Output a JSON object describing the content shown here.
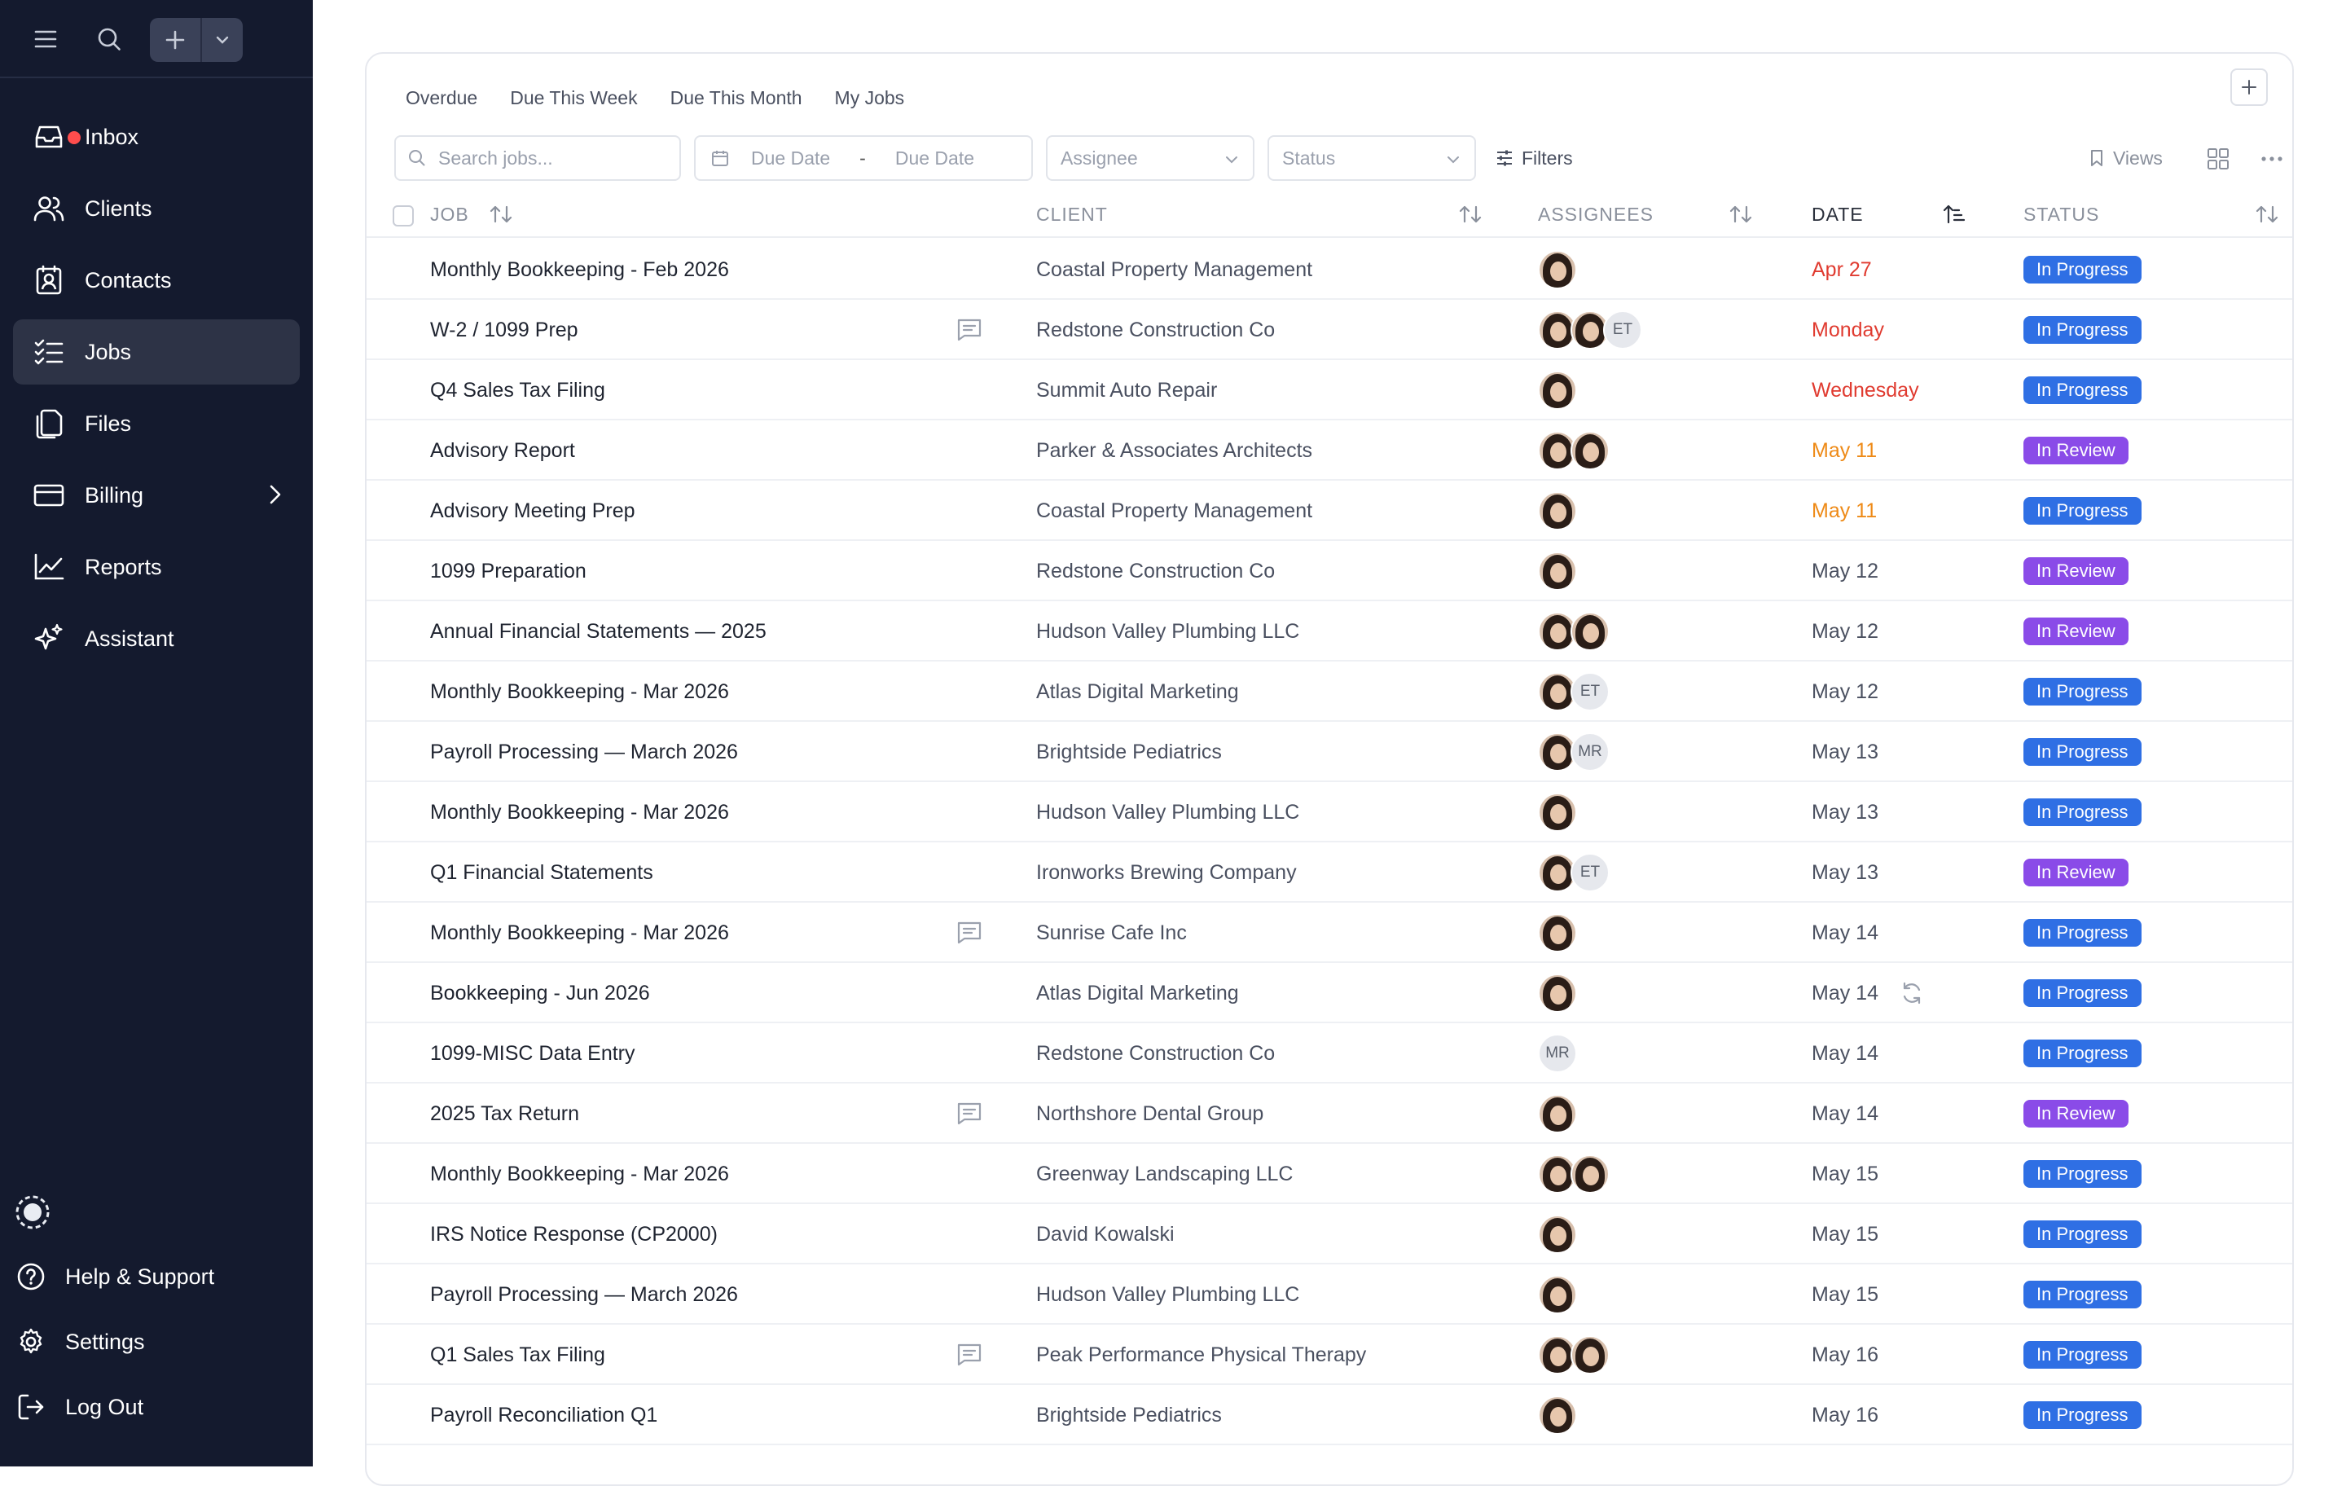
{
  "sidebar": {
    "nav": [
      {
        "label": "Inbox",
        "icon": "inbox-icon",
        "active": false,
        "badge": true
      },
      {
        "label": "Clients",
        "icon": "users-icon",
        "active": false
      },
      {
        "label": "Contacts",
        "icon": "contact-book-icon",
        "active": false
      },
      {
        "label": "Jobs",
        "icon": "checklist-icon",
        "active": true
      },
      {
        "label": "Files",
        "icon": "files-icon",
        "active": false
      },
      {
        "label": "Billing",
        "icon": "credit-card-icon",
        "active": false,
        "expandable": true
      },
      {
        "label": "Reports",
        "icon": "line-chart-icon",
        "active": false
      },
      {
        "label": "Assistant",
        "icon": "sparkles-icon",
        "active": false
      }
    ],
    "bottom": [
      {
        "label": "Help & Support",
        "icon": "help-circle-icon"
      },
      {
        "label": "Settings",
        "icon": "gear-icon"
      },
      {
        "label": "Log Out",
        "icon": "logout-icon"
      }
    ]
  },
  "tabs": [
    "Overdue",
    "Due This Week",
    "Due This Month",
    "My Jobs"
  ],
  "toolbar": {
    "search_placeholder": "Search jobs...",
    "due_date_start": "Due Date",
    "due_date_separator": "-",
    "due_date_end": "Due Date",
    "assignee_placeholder": "Assignee",
    "status_placeholder": "Status",
    "filters_label": "Filters",
    "views_label": "Views"
  },
  "columns": {
    "job": "JOB",
    "client": "CLIENT",
    "assignees": "ASSIGNEES",
    "date": "DATE",
    "status": "STATUS"
  },
  "colors": {
    "overdue": "#e03b30",
    "soon": "#ee8a17",
    "normal": "#4a5060",
    "in_progress": "#2f6fe4",
    "in_review": "#8a4be8"
  },
  "rows": [
    {
      "job": "Monthly Bookkeeping - Feb 2026",
      "client": "Coastal Property Management",
      "assignees": [
        {
          "type": "photo"
        }
      ],
      "date": "Apr 27",
      "date_state": "overdue",
      "status": "In Progress",
      "status_type": "progress"
    },
    {
      "job": "W-2 / 1099 Prep",
      "client": "Redstone Construction Co",
      "comment": true,
      "assignees": [
        {
          "type": "photo"
        },
        {
          "type": "photo"
        },
        {
          "type": "initials",
          "text": "ET"
        }
      ],
      "date": "Monday",
      "date_state": "overdue",
      "status": "In Progress",
      "status_type": "progress"
    },
    {
      "job": "Q4 Sales Tax Filing",
      "client": "Summit Auto Repair",
      "assignees": [
        {
          "type": "photo"
        }
      ],
      "date": "Wednesday",
      "date_state": "overdue",
      "status": "In Progress",
      "status_type": "progress"
    },
    {
      "job": "Advisory Report",
      "client": "Parker & Associates Architects",
      "assignees": [
        {
          "type": "photo"
        },
        {
          "type": "photo"
        }
      ],
      "date": "May 11",
      "date_state": "soon",
      "status": "In Review",
      "status_type": "review"
    },
    {
      "job": "Advisory Meeting Prep",
      "client": "Coastal Property Management",
      "assignees": [
        {
          "type": "photo"
        }
      ],
      "date": "May 11",
      "date_state": "soon",
      "status": "In Progress",
      "status_type": "progress"
    },
    {
      "job": "1099 Preparation",
      "client": "Redstone Construction Co",
      "assignees": [
        {
          "type": "photo"
        }
      ],
      "date": "May 12",
      "date_state": "normal",
      "status": "In Review",
      "status_type": "review"
    },
    {
      "job": "Annual Financial Statements — 2025",
      "client": "Hudson Valley Plumbing LLC",
      "assignees": [
        {
          "type": "photo"
        },
        {
          "type": "photo"
        }
      ],
      "date": "May 12",
      "date_state": "normal",
      "status": "In Review",
      "status_type": "review"
    },
    {
      "job": "Monthly Bookkeeping - Mar 2026",
      "client": "Atlas Digital Marketing",
      "assignees": [
        {
          "type": "photo"
        },
        {
          "type": "initials",
          "text": "ET"
        }
      ],
      "date": "May 12",
      "date_state": "normal",
      "status": "In Progress",
      "status_type": "progress"
    },
    {
      "job": "Payroll Processing — March 2026",
      "client": "Brightside Pediatrics",
      "assignees": [
        {
          "type": "photo"
        },
        {
          "type": "initials",
          "text": "MR"
        }
      ],
      "date": "May 13",
      "date_state": "normal",
      "status": "In Progress",
      "status_type": "progress"
    },
    {
      "job": "Monthly Bookkeeping - Mar 2026",
      "client": "Hudson Valley Plumbing LLC",
      "assignees": [
        {
          "type": "photo"
        }
      ],
      "date": "May 13",
      "date_state": "normal",
      "status": "In Progress",
      "status_type": "progress"
    },
    {
      "job": "Q1 Financial Statements",
      "client": "Ironworks Brewing Company",
      "assignees": [
        {
          "type": "photo"
        },
        {
          "type": "initials",
          "text": "ET"
        }
      ],
      "date": "May 13",
      "date_state": "normal",
      "status": "In Review",
      "status_type": "review"
    },
    {
      "job": "Monthly Bookkeeping - Mar 2026",
      "client": "Sunrise Cafe Inc",
      "comment": true,
      "assignees": [
        {
          "type": "photo"
        }
      ],
      "date": "May 14",
      "date_state": "normal",
      "status": "In Progress",
      "status_type": "progress"
    },
    {
      "job": "Bookkeeping - Jun 2026",
      "client": "Atlas Digital Marketing",
      "assignees": [
        {
          "type": "photo"
        }
      ],
      "date": "May 14",
      "date_state": "normal",
      "recurring": true,
      "status": "In Progress",
      "status_type": "progress"
    },
    {
      "job": "1099-MISC Data Entry",
      "client": "Redstone Construction Co",
      "assignees": [
        {
          "type": "initials",
          "text": "MR"
        }
      ],
      "date": "May 14",
      "date_state": "normal",
      "status": "In Progress",
      "status_type": "progress"
    },
    {
      "job": "2025 Tax Return",
      "client": "Northshore Dental Group",
      "comment": true,
      "assignees": [
        {
          "type": "photo"
        }
      ],
      "date": "May 14",
      "date_state": "normal",
      "status": "In Review",
      "status_type": "review"
    },
    {
      "job": "Monthly Bookkeeping - Mar 2026",
      "client": "Greenway Landscaping LLC",
      "assignees": [
        {
          "type": "photo"
        },
        {
          "type": "photo"
        }
      ],
      "date": "May 15",
      "date_state": "normal",
      "status": "In Progress",
      "status_type": "progress"
    },
    {
      "job": "IRS Notice Response (CP2000)",
      "client": "David Kowalski",
      "assignees": [
        {
          "type": "photo"
        }
      ],
      "date": "May 15",
      "date_state": "normal",
      "status": "In Progress",
      "status_type": "progress"
    },
    {
      "job": "Payroll Processing — March 2026",
      "client": "Hudson Valley Plumbing LLC",
      "assignees": [
        {
          "type": "photo"
        }
      ],
      "date": "May 15",
      "date_state": "normal",
      "status": "In Progress",
      "status_type": "progress"
    },
    {
      "job": "Q1 Sales Tax Filing",
      "client": "Peak Performance Physical Therapy",
      "comment": true,
      "assignees": [
        {
          "type": "photo"
        },
        {
          "type": "photo"
        }
      ],
      "date": "May 16",
      "date_state": "normal",
      "status": "In Progress",
      "status_type": "progress"
    },
    {
      "job": "Payroll Reconciliation Q1",
      "client": "Brightside Pediatrics",
      "assignees": [
        {
          "type": "photo"
        }
      ],
      "date": "May 16",
      "date_state": "normal",
      "status": "In Progress",
      "status_type": "progress"
    }
  ]
}
